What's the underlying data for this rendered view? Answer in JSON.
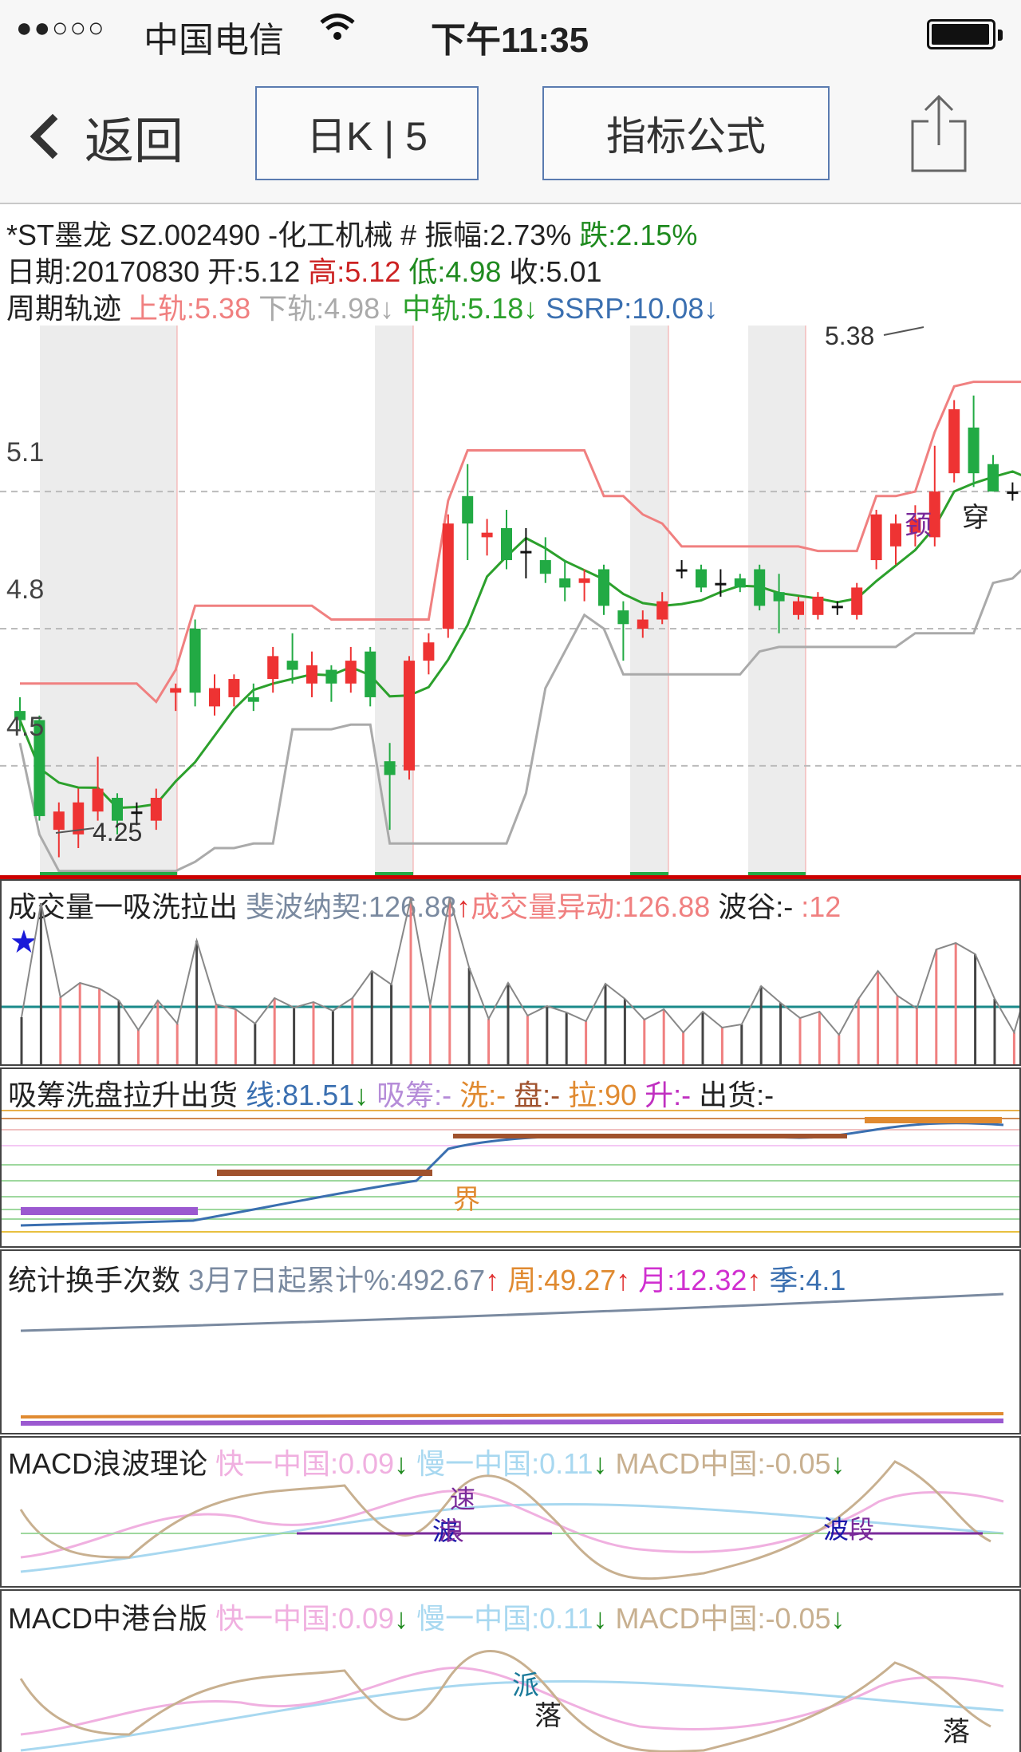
{
  "status": {
    "signal": "●●○○○",
    "carrier": "中国电信",
    "time": "下午11:35"
  },
  "nav": {
    "back_label": "返回",
    "period_label": "日K | 5",
    "formula_label": "指标公式"
  },
  "quote": {
    "line1": [
      {
        "t": "*ST墨龙 SZ.002490 -化工机械  # 振幅:2.73% ",
        "c": "#222"
      },
      {
        "t": "跌:2.15%",
        "c": "#1e8a1e"
      }
    ],
    "line2": [
      {
        "t": "日期:20170830 开:5.12 ",
        "c": "#222"
      },
      {
        "t": "高:5.12 ",
        "c": "#cc2222"
      },
      {
        "t": "低:4.98 ",
        "c": "#1e8a1e"
      },
      {
        "t": "收:5.01",
        "c": "#222"
      }
    ],
    "line3": [
      {
        "t": "周期轨迹 ",
        "c": "#222"
      },
      {
        "t": "上轨:5.38 ",
        "c": "#f08080"
      },
      {
        "t": "下轨:4.98↓ ",
        "c": "#aaaaaa"
      },
      {
        "t": "中轨:5.18↓ ",
        "c": "#2ca02c"
      },
      {
        "t": "SSRP:10.08↓",
        "c": "#3a6fb0"
      }
    ]
  },
  "kline": {
    "price_ticks": [
      "5.1",
      "4.8",
      "4.5"
    ],
    "high_label": "5.38",
    "low_label": "4.25",
    "annotations": [
      {
        "text": "颈",
        "color": "#7a2a9a"
      },
      {
        "text": "穿",
        "color": "#222"
      }
    ]
  },
  "volume": {
    "line": [
      {
        "t": "成交量一吸洗拉出 ",
        "c": "#222"
      },
      {
        "t": "斐波纳契:126.88",
        "c": "#7a8aa0"
      },
      {
        "t": "↑",
        "c": "#e03030"
      },
      {
        "t": "成交量异动:126.88 ",
        "c": "#f08080"
      },
      {
        "t": "波谷:- ",
        "c": "#222"
      },
      {
        "t": ":12",
        "c": "#f08080"
      }
    ],
    "star": "★"
  },
  "chip": {
    "line": [
      {
        "t": "吸筹洗盘拉升出货 ",
        "c": "#222"
      },
      {
        "t": "线:81.51",
        "c": "#3a6fb0"
      },
      {
        "t": "↓",
        "c": "#1e8a1e"
      },
      {
        "t": " 吸筹:- ",
        "c": "#b58cd8"
      },
      {
        "t": "洗:- ",
        "c": "#e08a30"
      },
      {
        "t": "盘:- ",
        "c": "#a0522d"
      },
      {
        "t": "拉:90 ",
        "c": "#e08a30"
      },
      {
        "t": "升:- ",
        "c": "#c030c0"
      },
      {
        "t": "出货:-",
        "c": "#222"
      }
    ],
    "mark": "界"
  },
  "turnover": {
    "line": [
      {
        "t": "统计换手次数 ",
        "c": "#222"
      },
      {
        "t": "3月7日起累计%:492.67",
        "c": "#7a8aa0"
      },
      {
        "t": "↑",
        "c": "#e03030"
      },
      {
        "t": " 周:49.27",
        "c": "#e08a30"
      },
      {
        "t": "↑",
        "c": "#e03030"
      },
      {
        "t": " 月:12.32",
        "c": "#d030d0"
      },
      {
        "t": "↑",
        "c": "#e03030"
      },
      {
        "t": " 季:4.1",
        "c": "#3a6fb0"
      }
    ]
  },
  "macd1": {
    "line": [
      {
        "t": "MACD浪波理论 ",
        "c": "#222"
      },
      {
        "t": "快一中国:0.09",
        "c": "#f0b0e0"
      },
      {
        "t": "↓",
        "c": "#1e8a1e"
      },
      {
        "t": " 慢一中国:0.11",
        "c": "#a8d8f0"
      },
      {
        "t": "↓",
        "c": "#1e8a1e"
      },
      {
        "t": " MACD中国:-0.05",
        "c": "#c8b090"
      },
      {
        "t": "↓",
        "c": "#1e8a1e"
      }
    ],
    "marks": [
      {
        "text": "速",
        "color": "#7a2a9a"
      },
      {
        "text": "波",
        "color": "#1a1aaa"
      },
      {
        "text": "浪",
        "color": "#7a2a9a"
      },
      {
        "text": "波",
        "color": "#1a1aaa"
      },
      {
        "text": "段",
        "color": "#7a2a9a"
      }
    ]
  },
  "macd2": {
    "line": [
      {
        "t": "MACD中港台版 ",
        "c": "#222"
      },
      {
        "t": "快一中国:0.09",
        "c": "#f0b0e0"
      },
      {
        "t": "↓",
        "c": "#1e8a1e"
      },
      {
        "t": " 慢一中国:0.11",
        "c": "#a8d8f0"
      },
      {
        "t": "↓",
        "c": "#1e8a1e"
      },
      {
        "t": " MACD中国:-0.05",
        "c": "#c8b090"
      },
      {
        "t": "↓",
        "c": "#1e8a1e"
      }
    ],
    "marks": [
      {
        "text": "派",
        "color": "#1a7a9a"
      },
      {
        "text": "落",
        "color": "#222"
      },
      {
        "text": "落",
        "color": "#222"
      }
    ]
  },
  "colors": {
    "up": "#ee3333",
    "down": "#22aa44",
    "upper": "#f08080",
    "lower": "#aaaaaa",
    "mid": "#2ca02c",
    "divider": "#cc0000"
  },
  "candles": [
    [
      4.62,
      4.6,
      4.65,
      4.58
    ],
    [
      4.6,
      4.39,
      4.61,
      4.38
    ],
    [
      4.36,
      4.4,
      4.42,
      4.3
    ],
    [
      4.35,
      4.42,
      4.45,
      4.32
    ],
    [
      4.4,
      4.45,
      4.52,
      4.38
    ],
    [
      4.43,
      4.38,
      4.44,
      4.35
    ],
    [
      4.4,
      4.4,
      4.42,
      4.37
    ],
    [
      4.38,
      4.43,
      4.45,
      4.36
    ],
    [
      4.66,
      4.67,
      4.68,
      4.62
    ],
    [
      4.8,
      4.66,
      4.82,
      4.63
    ],
    [
      4.63,
      4.67,
      4.7,
      4.61
    ],
    [
      4.65,
      4.69,
      4.7,
      4.63
    ],
    [
      4.65,
      4.64,
      4.68,
      4.62
    ],
    [
      4.69,
      4.74,
      4.76,
      4.66
    ],
    [
      4.73,
      4.71,
      4.79,
      4.68
    ],
    [
      4.68,
      4.72,
      4.75,
      4.65
    ],
    [
      4.71,
      4.68,
      4.72,
      4.64
    ],
    [
      4.68,
      4.73,
      4.76,
      4.66
    ],
    [
      4.75,
      4.65,
      4.76,
      4.63
    ],
    [
      4.51,
      4.48,
      4.55,
      4.36
    ],
    [
      4.49,
      4.73,
      4.74,
      4.47
    ],
    [
      4.73,
      4.77,
      4.79,
      4.7
    ],
    [
      4.8,
      5.03,
      5.05,
      4.78
    ],
    [
      5.09,
      5.03,
      5.16,
      4.95
    ],
    [
      5.0,
      5.01,
      5.04,
      4.96
    ],
    [
      5.02,
      4.95,
      5.06,
      4.93
    ],
    [
      4.97,
      4.97,
      5.02,
      4.91
    ],
    [
      4.95,
      4.92,
      5.0,
      4.9
    ],
    [
      4.91,
      4.89,
      4.95,
      4.86
    ],
    [
      4.9,
      4.91,
      4.93,
      4.86
    ],
    [
      4.93,
      4.85,
      4.94,
      4.83
    ],
    [
      4.84,
      4.81,
      4.86,
      4.73
    ],
    [
      4.8,
      4.82,
      4.84,
      4.78
    ],
    [
      4.82,
      4.86,
      4.88,
      4.81
    ],
    [
      4.93,
      4.93,
      4.95,
      4.91
    ],
    [
      4.93,
      4.89,
      4.94,
      4.88
    ],
    [
      4.9,
      4.9,
      4.93,
      4.87
    ],
    [
      4.91,
      4.89,
      4.92,
      4.88
    ],
    [
      4.93,
      4.85,
      4.94,
      4.84
    ],
    [
      4.88,
      4.86,
      4.92,
      4.79
    ],
    [
      4.83,
      4.86,
      4.87,
      4.82
    ],
    [
      4.83,
      4.87,
      4.88,
      4.82
    ],
    [
      4.85,
      4.85,
      4.86,
      4.83
    ],
    [
      4.83,
      4.89,
      4.9,
      4.82
    ],
    [
      4.95,
      5.05,
      5.06,
      4.93
    ],
    [
      4.98,
      5.03,
      5.05,
      4.94
    ],
    [
      5.01,
      5.04,
      5.07,
      4.98
    ],
    [
      5.0,
      5.1,
      5.2,
      4.98
    ],
    [
      5.14,
      5.28,
      5.3,
      5.12
    ],
    [
      5.24,
      5.14,
      5.31,
      5.11
    ],
    [
      5.16,
      5.1,
      5.18,
      5.1
    ],
    [
      5.1,
      5.1,
      5.12,
      5.08
    ],
    [
      5.12,
      5.01,
      5.12,
      4.98
    ]
  ]
}
